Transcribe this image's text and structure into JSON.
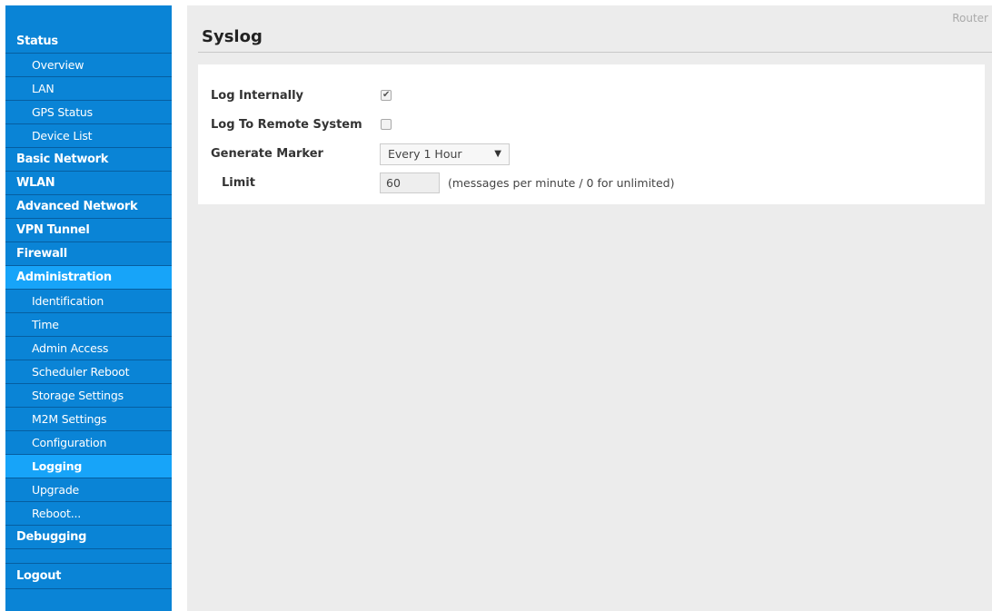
{
  "sidebar": {
    "items": [
      {
        "label": "Status",
        "level": "top",
        "active": false
      },
      {
        "label": "Overview",
        "level": "sub",
        "active": false
      },
      {
        "label": "LAN",
        "level": "sub",
        "active": false
      },
      {
        "label": "GPS Status",
        "level": "sub",
        "active": false
      },
      {
        "label": "Device List",
        "level": "sub",
        "active": false
      },
      {
        "label": "Basic Network",
        "level": "top",
        "active": false
      },
      {
        "label": "WLAN",
        "level": "top",
        "active": false
      },
      {
        "label": "Advanced Network",
        "level": "top",
        "active": false
      },
      {
        "label": "VPN Tunnel",
        "level": "top",
        "active": false
      },
      {
        "label": "Firewall",
        "level": "top",
        "active": false
      },
      {
        "label": "Administration",
        "level": "top",
        "active": true
      },
      {
        "label": "Identification",
        "level": "sub",
        "active": false
      },
      {
        "label": "Time",
        "level": "sub",
        "active": false
      },
      {
        "label": "Admin Access",
        "level": "sub",
        "active": false
      },
      {
        "label": "Scheduler Reboot",
        "level": "sub",
        "active": false
      },
      {
        "label": "Storage Settings",
        "level": "sub",
        "active": false
      },
      {
        "label": "M2M Settings",
        "level": "sub",
        "active": false
      },
      {
        "label": "Configuration",
        "level": "sub",
        "active": false
      },
      {
        "label": "Logging",
        "level": "sub",
        "active": true
      },
      {
        "label": "Upgrade",
        "level": "sub",
        "active": false
      },
      {
        "label": "Reboot...",
        "level": "sub",
        "active": false
      },
      {
        "label": "Debugging",
        "level": "top",
        "active": false
      }
    ],
    "logout": "Logout"
  },
  "header": {
    "brand": "Router",
    "title": "Syslog"
  },
  "form": {
    "log_internally": {
      "label": "Log Internally",
      "checked": true
    },
    "log_remote": {
      "label": "Log To Remote System",
      "checked": false
    },
    "generate_marker": {
      "label": "Generate Marker",
      "value": "Every 1 Hour"
    },
    "limit": {
      "label": "Limit",
      "value": "60",
      "hint": "(messages per minute / 0 for unlimited)"
    }
  },
  "colors": {
    "sidebar_bg": "#0a84d6",
    "active_bg": "#17a4f9",
    "content_bg": "#ececec"
  }
}
